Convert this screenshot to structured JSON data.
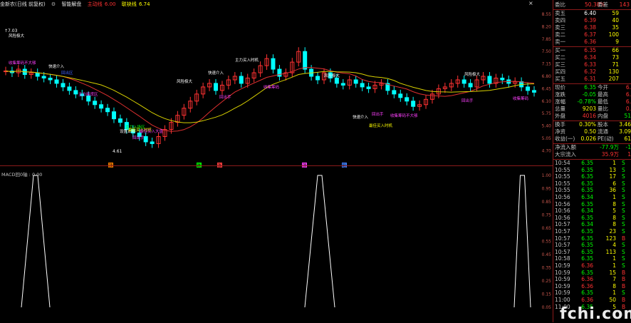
{
  "header": {
    "stock_name": "金新农(日线 前复权)",
    "indicator_name": "智能解盘",
    "main_force_label": "主动线",
    "main_force_value": "6.00",
    "joint_label": "联袂线",
    "joint_value": "6.74",
    "close_symbol": "×"
  },
  "colors": {
    "up": "#ff3232",
    "down": "#00ffff",
    "ma_red": "#e03030",
    "ma_yellow": "#d8d000",
    "grid": "#8b1a1a",
    "bg": "#000000"
  },
  "price_axis": [
    "8.55",
    "8.20",
    "7.85",
    "7.50",
    "7.15",
    "6.80",
    "6.45",
    "6.10",
    "5.75",
    "5.40",
    "5.05",
    "4.70"
  ],
  "macd_axis": [
    "1.00",
    "0.95",
    "0.85",
    "0.75",
    "0.65",
    "0.55",
    "0.45",
    "0.35",
    "0.25",
    "0.15",
    "0.05"
  ],
  "annotations": {
    "high": "↑7.03",
    "low": "4.61",
    "labels": [
      {
        "t": "风险极大",
        "c": "#ffffff"
      },
      {
        "t": "收集筹码不大够",
        "c": "#ff40ff"
      },
      {
        "t": "快速介入",
        "c": "#ffffff"
      },
      {
        "t": "回出区",
        "c": "#4060ff"
      },
      {
        "t": "主力接货区",
        "c": "#ff40ff"
      },
      {
        "t": "设置止损",
        "c": "#ffffff"
      },
      {
        "t": "主力入场区",
        "c": "#00ff00"
      },
      {
        "t": "最佳买入时机",
        "c": "#ffff00"
      },
      {
        "t": "最佳买入大盘",
        "c": "#ff40ff"
      },
      {
        "t": "回出手",
        "c": "#ff40ff"
      },
      {
        "t": "风险极大",
        "c": "#ffffff"
      },
      {
        "t": "快速介入",
        "c": "#ffffff"
      },
      {
        "t": "主力买入时机",
        "c": "#ffffff"
      },
      {
        "t": "回出手",
        "c": "#ff40ff"
      },
      {
        "t": "收集筹码",
        "c": "#ff40ff"
      },
      {
        "t": "风险极大",
        "c": "#ffffff"
      },
      {
        "t": "快速介入",
        "c": "#ffffff"
      },
      {
        "t": "最佳买入时机",
        "c": "#ffff00"
      },
      {
        "t": "回出手",
        "c": "#ff40ff"
      },
      {
        "t": "收集筹码不大够",
        "c": "#ff40ff"
      },
      {
        "t": "风险极大",
        "c": "#ffffff"
      },
      {
        "t": "回出手",
        "c": "#ff40ff"
      },
      {
        "t": "收集筹码",
        "c": "#ff40ff"
      }
    ],
    "bottom_tags": [
      "顶",
      "跌",
      "涨",
      "顶",
      "轻"
    ]
  },
  "macd": {
    "label": "MACD回0轴 : 0.00"
  },
  "quote": {
    "wei_bi_label": "委比",
    "wei_bi": "50.38%",
    "wei_cha_label": "委差",
    "wei_cha": "143",
    "asks": [
      {
        "label": "卖五",
        "price": "6.40",
        "vol": "59"
      },
      {
        "label": "卖四",
        "price": "6.39",
        "vol": "40"
      },
      {
        "label": "卖三",
        "price": "6.38",
        "vol": "35"
      },
      {
        "label": "卖二",
        "price": "6.37",
        "vol": "100"
      },
      {
        "label": "卖一",
        "price": "6.36",
        "vol": "9"
      }
    ],
    "bids": [
      {
        "label": "买一",
        "price": "6.35",
        "vol": "66"
      },
      {
        "label": "买二",
        "price": "6.34",
        "vol": "73"
      },
      {
        "label": "买三",
        "price": "6.33",
        "vol": "71"
      },
      {
        "label": "买四",
        "price": "6.32",
        "vol": "130"
      },
      {
        "label": "买五",
        "price": "6.31",
        "vol": "207"
      }
    ],
    "stats": [
      {
        "l1": "现价",
        "v1": "6.35",
        "l2": "今开",
        "v2": "6."
      },
      {
        "l1": "涨跌",
        "v1": "-0.05",
        "l2": "最高",
        "v2": "6."
      },
      {
        "l1": "涨幅",
        "v1": "-0.78%",
        "l2": "最低",
        "v2": "6."
      },
      {
        "l1": "总量",
        "v1": "9203",
        "l2": "量比",
        "v2": "0."
      },
      {
        "l1": "外盘",
        "v1": "4016",
        "l2": "内盘",
        "v2": "51"
      }
    ],
    "stats2": [
      {
        "l1": "换手",
        "v1": "0.30%",
        "l2": "股本",
        "v2": "3.46"
      },
      {
        "l1": "净资",
        "v1": "0.50",
        "l2": "流通",
        "v2": "3.09"
      },
      {
        "l1": "收益(一)",
        "v1": "0.026",
        "l2": "PE(动)",
        "v2": "61"
      }
    ],
    "flows": [
      {
        "label": "净流入额",
        "v1": "-77.9万",
        "v2": "-1"
      },
      {
        "label": "大宗流入",
        "v1": "35.9万",
        "v2": "1"
      }
    ],
    "ticks": [
      [
        "10:54",
        "6.35",
        "1",
        "S"
      ],
      [
        "10:55",
        "6.35",
        "13",
        "S"
      ],
      [
        "10:55",
        "6.35",
        "17",
        "S"
      ],
      [
        "10:55",
        "6.35",
        "6",
        "S"
      ],
      [
        "10:55",
        "6.35",
        "36",
        "S"
      ],
      [
        "10:56",
        "6.34",
        "1",
        "S"
      ],
      [
        "10:56",
        "6.35",
        "8",
        "S"
      ],
      [
        "10:56",
        "6.34",
        "5",
        "S"
      ],
      [
        "10:56",
        "6.35",
        "8",
        "S"
      ],
      [
        "10:57",
        "6.34",
        "8",
        "S"
      ],
      [
        "10:57",
        "6.35",
        "23",
        "S"
      ],
      [
        "10:57",
        "6.35",
        "123",
        "B"
      ],
      [
        "10:57",
        "6.35",
        "4",
        "S"
      ],
      [
        "10:57",
        "6.35",
        "113",
        "S"
      ],
      [
        "10:58",
        "6.35",
        "1",
        "S"
      ],
      [
        "10:59",
        "6.36",
        "1",
        "S"
      ],
      [
        "10:59",
        "6.35",
        "15",
        "B"
      ],
      [
        "10:59",
        "6.36",
        "7",
        "B"
      ],
      [
        "10:59",
        "6.36",
        "8",
        "B"
      ],
      [
        "10:59",
        "6.35",
        "1",
        "S"
      ],
      [
        "11:00",
        "6.36",
        "50",
        "B"
      ],
      [
        "11:00",
        "6.35",
        "5",
        "B"
      ]
    ],
    "watermark": "fchi.com"
  }
}
